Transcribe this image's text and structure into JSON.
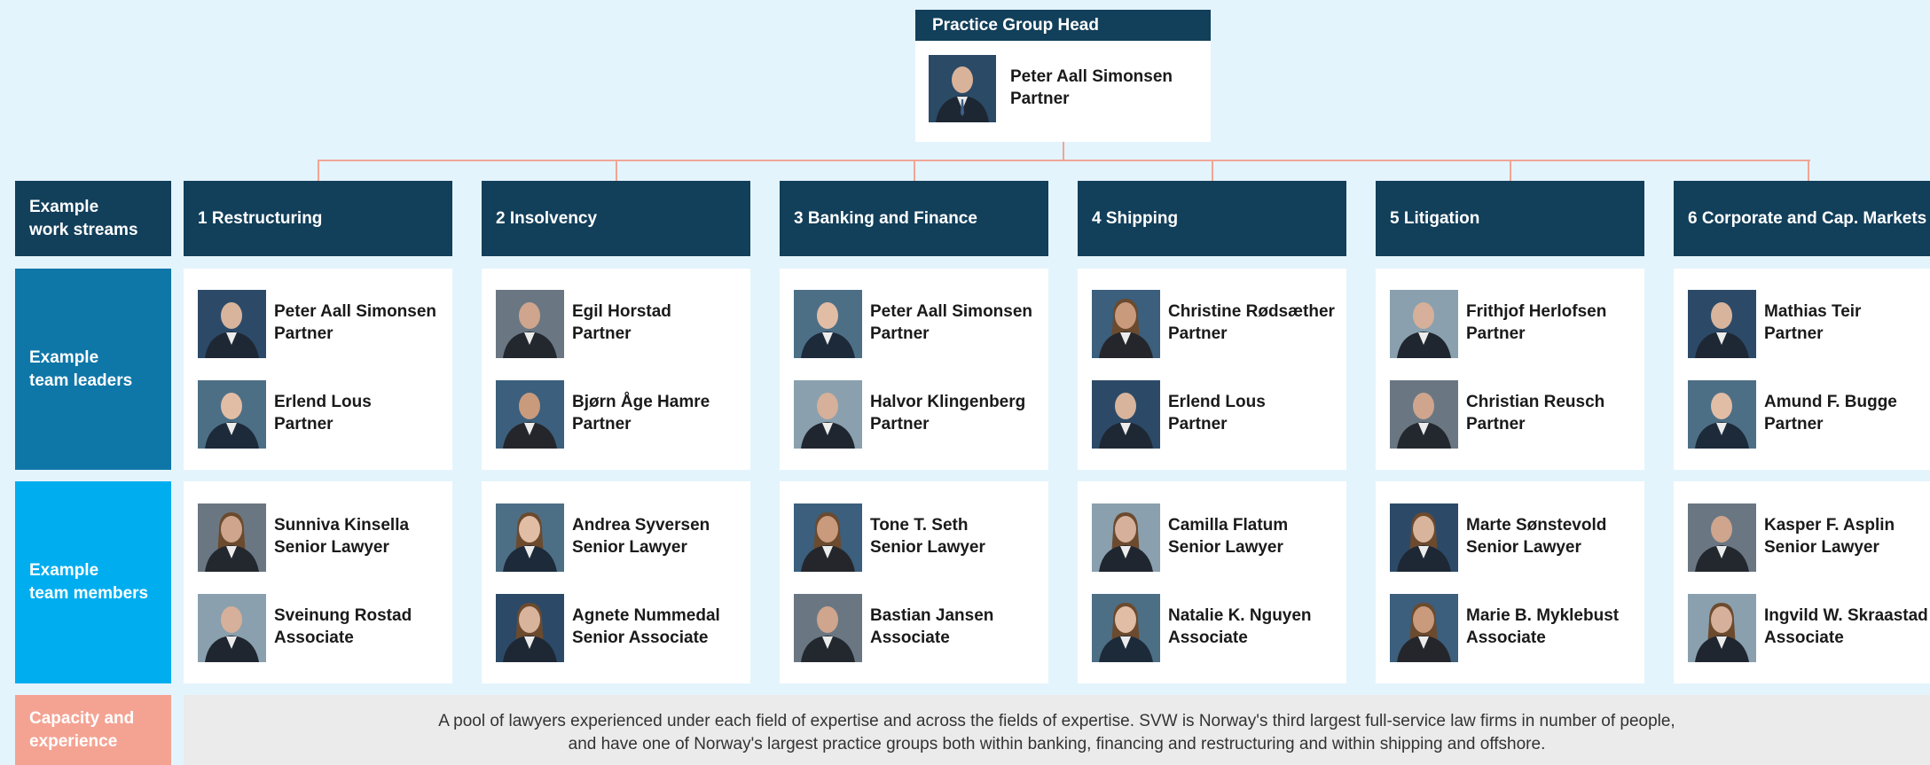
{
  "head": {
    "title": "Practice Group Head",
    "name": "Peter Aall Simonsen",
    "role": "Partner"
  },
  "row_labels": {
    "streams": [
      "Example",
      "work streams"
    ],
    "leaders": [
      "Example",
      "team leaders"
    ],
    "members": [
      "Example",
      "team members"
    ],
    "capacity": [
      "Capacity and",
      "experience"
    ]
  },
  "streams": [
    {
      "title": "1 Restructuring",
      "leaders": [
        {
          "name": "Peter Aall Simonsen",
          "role": "Partner"
        },
        {
          "name": "Erlend Lous",
          "role": "Partner"
        }
      ],
      "members": [
        {
          "name": "Sunniva Kinsella",
          "role": "Senior Lawyer"
        },
        {
          "name": "Sveinung Rostad",
          "role": "Associate"
        }
      ]
    },
    {
      "title": "2 Insolvency",
      "leaders": [
        {
          "name": "Egil Horstad",
          "role": "Partner"
        },
        {
          "name": "Bjørn Åge Hamre",
          "role": "Partner"
        }
      ],
      "members": [
        {
          "name": "Andrea Syversen",
          "role": "Senior Lawyer"
        },
        {
          "name": "Agnete Nummedal",
          "role": "Senior Associate"
        }
      ]
    },
    {
      "title": "3 Banking and Finance",
      "leaders": [
        {
          "name": "Peter Aall Simonsen",
          "role": "Partner"
        },
        {
          "name": "Halvor Klingenberg",
          "role": "Partner"
        }
      ],
      "members": [
        {
          "name": "Tone T. Seth",
          "role": "Senior Lawyer"
        },
        {
          "name": "Bastian Jansen",
          "role": "Associate"
        }
      ]
    },
    {
      "title": "4 Shipping",
      "leaders": [
        {
          "name": "Christine Rødsæther",
          "role": "Partner"
        },
        {
          "name": "Erlend Lous",
          "role": "Partner"
        }
      ],
      "members": [
        {
          "name": "Camilla Flatum",
          "role": "Senior Lawyer"
        },
        {
          "name": "Natalie K. Nguyen",
          "role": "Associate"
        }
      ]
    },
    {
      "title": "5 Litigation",
      "leaders": [
        {
          "name": "Frithjof Herlofsen",
          "role": "Partner"
        },
        {
          "name": "Christian Reusch",
          "role": "Partner"
        }
      ],
      "members": [
        {
          "name": "Marte Sønstevold",
          "role": "Senior Lawyer"
        },
        {
          "name": "Marie B. Myklebust",
          "role": "Associate"
        }
      ]
    },
    {
      "title": "6 Corporate and Cap. Markets",
      "leaders": [
        {
          "name": "Mathias Teir",
          "role": "Partner"
        },
        {
          "name": "Amund F. Bugge",
          "role": "Partner"
        }
      ],
      "members": [
        {
          "name": "Kasper F. Asplin",
          "role": "Senior Lawyer"
        },
        {
          "name": "Ingvild W. Skraastad",
          "role": "Associate"
        }
      ]
    }
  ],
  "capacity_text": [
    "A pool of lawyers experienced under each field of expertise and across the fields of expertise. SVW is Norway's third largest full-service law firms in number of people,",
    "and have one of Norway's largest practice groups both within banking, financing and restructuring and within shipping and offshore."
  ],
  "colors": {
    "dark_navy": "#123f5a",
    "mid_blue": "#0f77a8",
    "bright_blue": "#00adef",
    "salmon": "#f4a393",
    "background": "#e4f4fc",
    "connector": "#f0a595"
  }
}
